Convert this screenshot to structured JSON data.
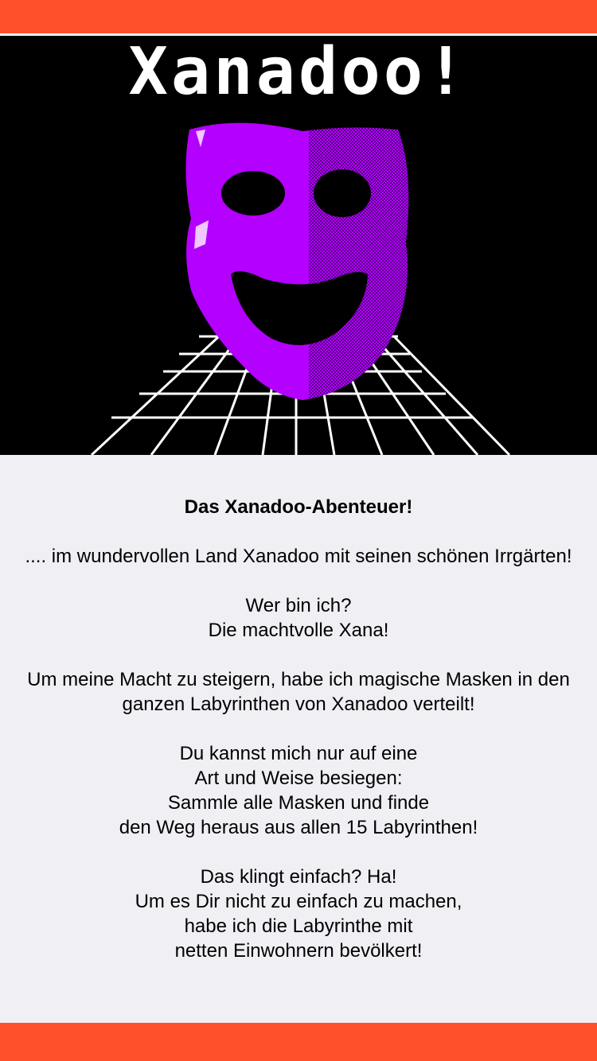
{
  "colors": {
    "accent_bar": "#ff4f2b",
    "background": "#efeff4",
    "hero_background": "#000000",
    "mask_light": "#b300ff",
    "mask_dark": "#7a00b0",
    "grid": "#ffffff"
  },
  "hero": {
    "title": "Xanadoo!",
    "image_icon": "purple-mask-over-grid"
  },
  "story": {
    "headline": "Das Xanadoo-Abenteuer!",
    "intro": ".... im wundervollen Land Xanadoo mit seinen schönen Irrgärten!",
    "who_question": "Wer bin ich?",
    "who_answer": "Die machtvolle Xana!",
    "power": "Um meine Macht zu steigern, habe ich magische Masken in den ganzen Labyrinthen von Xanadoo verteilt!",
    "defeat_lines": [
      "Du kannst mich nur auf eine",
      "Art und Weise besiegen:",
      "Sammle alle Masken und finde",
      "den Weg heraus aus allen 15 Labyrinthen!"
    ],
    "challenge_lines": [
      "Das klingt einfach? Ha!",
      "Um es Dir nicht zu einfach zu machen,",
      "habe ich die Labyrinthe mit",
      "netten Einwohnern bevölkert!"
    ]
  }
}
